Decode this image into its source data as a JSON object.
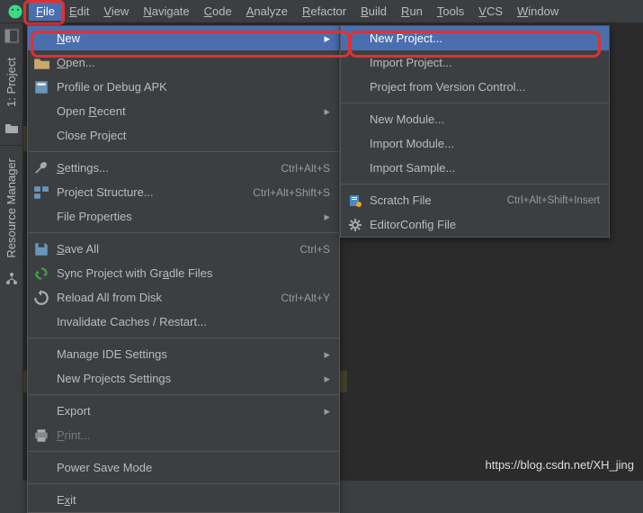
{
  "menubar": {
    "items": [
      "File",
      "Edit",
      "View",
      "Navigate",
      "Code",
      "Analyze",
      "Refactor",
      "Build",
      "Run",
      "Tools",
      "VCS",
      "Window"
    ]
  },
  "sidebar": {
    "project": "1: Project",
    "rm": "Resource Manager"
  },
  "fileMenu": [
    {
      "icon": "",
      "label": "New",
      "arrow": true,
      "hl": true,
      "u": 0
    },
    {
      "icon": "folder",
      "label": "Open...",
      "u": 0
    },
    {
      "icon": "profile",
      "label": "Profile or Debug APK"
    },
    {
      "indent": true,
      "label": "Open Recent",
      "arrow": true,
      "u": 5
    },
    {
      "indent": true,
      "label": "Close Project"
    },
    {
      "sep": true
    },
    {
      "icon": "wrench",
      "label": "Settings...",
      "shortcut": "Ctrl+Alt+S",
      "u": 0
    },
    {
      "icon": "structure",
      "label": "Project Structure...",
      "shortcut": "Ctrl+Alt+Shift+S"
    },
    {
      "indent": true,
      "label": "File Properties",
      "arrow": true
    },
    {
      "sep": true
    },
    {
      "icon": "save",
      "label": "Save All",
      "shortcut": "Ctrl+S",
      "u": 0
    },
    {
      "icon": "sync",
      "label": "Sync Project with Gradle Files",
      "u": 20
    },
    {
      "icon": "reload",
      "label": "Reload All from Disk",
      "shortcut": "Ctrl+Alt+Y"
    },
    {
      "indent": true,
      "label": "Invalidate Caches / Restart..."
    },
    {
      "sep": true
    },
    {
      "indent": true,
      "label": "Manage IDE Settings",
      "arrow": true
    },
    {
      "indent": true,
      "label": "New Projects Settings",
      "arrow": true
    },
    {
      "sep": true
    },
    {
      "indent": true,
      "label": "Export",
      "arrow": true
    },
    {
      "icon": "print",
      "label": "Print...",
      "disabled": true,
      "u": 0
    },
    {
      "sep": true
    },
    {
      "indent": true,
      "label": "Power Save Mode"
    },
    {
      "sep": true
    },
    {
      "indent": true,
      "label": "Exit",
      "u": 1
    }
  ],
  "newMenu": [
    {
      "label": "New Project...",
      "hl": true
    },
    {
      "label": "Import Project..."
    },
    {
      "label": "Project from Version Control..."
    },
    {
      "sep": true
    },
    {
      "label": "New Module..."
    },
    {
      "label": "Import Module..."
    },
    {
      "label": "Import Sample..."
    },
    {
      "sep": true
    },
    {
      "icon": "scratch",
      "label": "Scratch File",
      "shortcut": "Ctrl+Alt+Shift+Insert"
    },
    {
      "icon": "gear",
      "label": "EditorConfig File"
    }
  ],
  "watermark": "https://blog.csdn.net/XH_jing"
}
